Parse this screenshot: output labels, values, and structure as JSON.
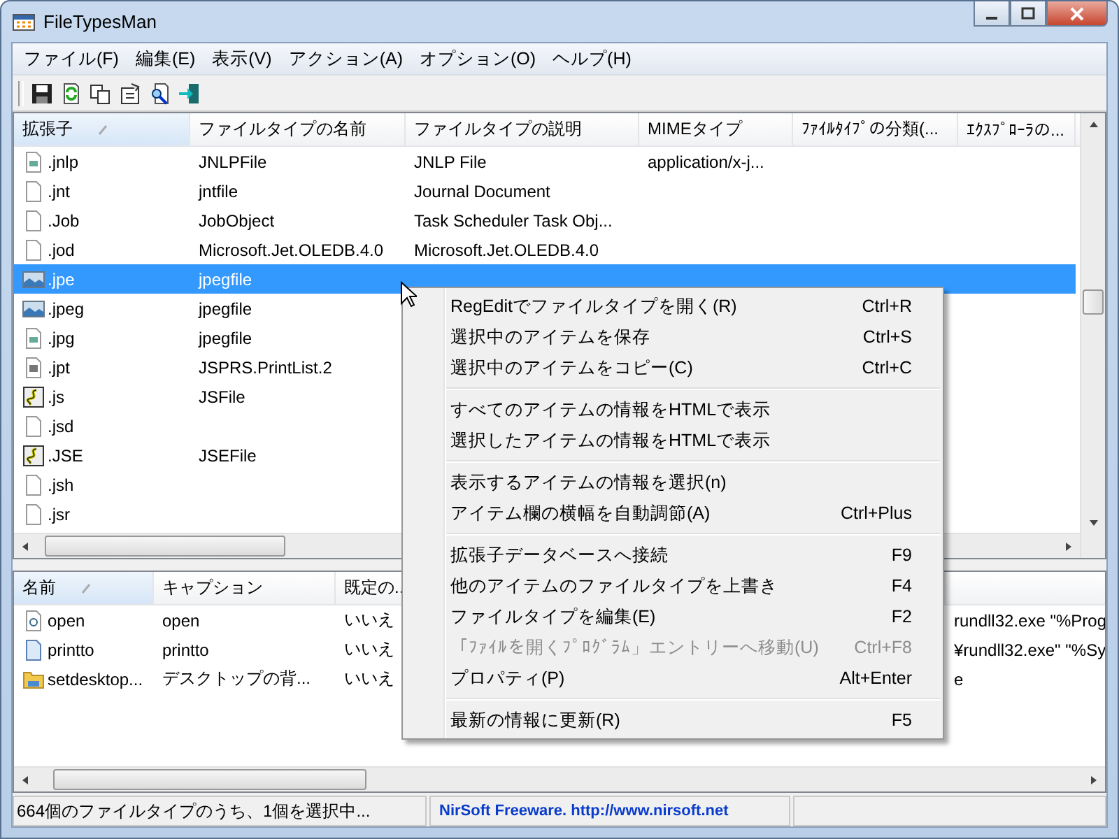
{
  "window": {
    "title": "FileTypesMan"
  },
  "menu_bar": [
    "ファイル(F)",
    "編集(E)",
    "表示(V)",
    "アクション(A)",
    "オプション(O)",
    "ヘルプ(H)"
  ],
  "toolbar": [
    {
      "kind": "save"
    },
    {
      "kind": "refresh"
    },
    {
      "kind": "copy"
    },
    {
      "kind": "properties"
    },
    {
      "kind": "find"
    },
    {
      "kind": "exit"
    }
  ],
  "file_types": {
    "columns": [
      {
        "label": "拡張子",
        "sorted": true
      },
      {
        "label": "ファイルタイプの名前",
        "sorted": false
      },
      {
        "label": "ファイルタイプの説明",
        "sorted": false
      },
      {
        "label": "MIMEタイプ",
        "sorted": false
      },
      {
        "label": "ﾌｧｲﾙﾀｲﾌﾟの分類(...",
        "sorted": false
      },
      {
        "label": "ｴｸｽﾌﾟﾛｰﾗの...",
        "sorted": false
      }
    ],
    "rows": [
      {
        "kind": "image",
        "selected": false,
        "cells": [
          ".jnlp",
          "JNLPFile",
          "JNLP File",
          "application/x-j...",
          "",
          ""
        ]
      },
      {
        "kind": "blank",
        "selected": false,
        "cells": [
          ".jnt",
          "jntfile",
          "Journal Document",
          "",
          "",
          ""
        ]
      },
      {
        "kind": "blank",
        "selected": false,
        "cells": [
          ".Job",
          "JobObject",
          "Task Scheduler Task Obj...",
          "",
          "",
          ""
        ]
      },
      {
        "kind": "blank",
        "selected": false,
        "cells": [
          ".jod",
          "Microsoft.Jet.OLEDB.4.0",
          "Microsoft.Jet.OLEDB.4.0",
          "",
          "",
          ""
        ]
      },
      {
        "kind": "picture",
        "selected": true,
        "cells": [
          ".jpe",
          "jpegfile",
          "",
          "",
          "",
          ""
        ]
      },
      {
        "kind": "picture",
        "selected": false,
        "cells": [
          ".jpeg",
          "jpegfile",
          "",
          "",
          "",
          ""
        ]
      },
      {
        "kind": "image",
        "selected": false,
        "cells": [
          ".jpg",
          "jpegfile",
          "",
          "",
          "",
          ""
        ]
      },
      {
        "kind": "print",
        "selected": false,
        "cells": [
          ".jpt",
          "JSPRS.PrintList.2",
          "",
          "",
          "",
          ""
        ]
      },
      {
        "kind": "script",
        "selected": false,
        "cells": [
          ".js",
          "JSFile",
          "",
          "",
          "",
          ""
        ]
      },
      {
        "kind": "blank",
        "selected": false,
        "cells": [
          ".jsd",
          "",
          "",
          "",
          "",
          ""
        ]
      },
      {
        "kind": "script",
        "selected": false,
        "cells": [
          ".JSE",
          "JSEFile",
          "",
          "",
          "",
          ""
        ]
      },
      {
        "kind": "blank",
        "selected": false,
        "cells": [
          ".jsh",
          "",
          "",
          "",
          "",
          ""
        ]
      },
      {
        "kind": "blank",
        "selected": false,
        "cells": [
          ".jsr",
          "",
          "",
          "",
          "",
          ""
        ]
      }
    ]
  },
  "actions": {
    "columns": [
      {
        "label": "名前",
        "sorted": true
      },
      {
        "label": "キャプション",
        "sorted": false
      },
      {
        "label": "既定の..",
        "sorted": false
      }
    ],
    "rows": [
      {
        "kind": "action",
        "selected": false,
        "cells": [
          "open",
          "open",
          "いいえ",
          "rundll32.exe \"%Prog"
        ]
      },
      {
        "kind": "doc",
        "selected": false,
        "cells": [
          "printto",
          "printto",
          "いいえ",
          "¥rundll32.exe\" \"%Sy"
        ]
      },
      {
        "kind": "folder",
        "selected": false,
        "cells": [
          "setdesktop...",
          "デスクトップの背...",
          "いいえ",
          "e"
        ]
      }
    ]
  },
  "context_menu": [
    [
      {
        "label": "RegEditでファイルタイプを開く(R)",
        "shortcut": "Ctrl+R",
        "disabled": false
      },
      {
        "label": "選択中のアイテムを保存",
        "shortcut": "Ctrl+S",
        "disabled": false
      },
      {
        "label": "選択中のアイテムをコピー(C)",
        "shortcut": "Ctrl+C",
        "disabled": false
      }
    ],
    [
      {
        "label": "すべてのアイテムの情報をHTMLで表示",
        "disabled": false
      },
      {
        "label": "選択したアイテムの情報をHTMLで表示",
        "disabled": false
      }
    ],
    [
      {
        "label": "表示するアイテムの情報を選択(n)",
        "disabled": false
      },
      {
        "label": "アイテム欄の横幅を自動調節(A)",
        "shortcut": "Ctrl+Plus",
        "disabled": false
      }
    ],
    [
      {
        "label": "拡張子データベースへ接続",
        "shortcut": "F9",
        "disabled": false
      },
      {
        "label": "他のアイテムのファイルタイプを上書き",
        "shortcut": "F4",
        "disabled": false
      },
      {
        "label": "ファイルタイプを編集(E)",
        "shortcut": "F2",
        "disabled": false
      },
      {
        "label": "「ﾌｧｲﾙを開くﾌﾟﾛｸﾞﾗﾑ」エントリーへ移動(U)",
        "shortcut": "Ctrl+F8",
        "disabled": true
      },
      {
        "label": "プロパティ(P)",
        "shortcut": "Alt+Enter",
        "disabled": false
      }
    ],
    [
      {
        "label": "最新の情報に更新(R)",
        "shortcut": "F5",
        "disabled": false
      }
    ]
  ],
  "status_bar": {
    "summary": "664個のファイルタイプのうち、1個を選択中...",
    "link": "NirSoft Freeware.  http://www.nirsoft.net"
  }
}
